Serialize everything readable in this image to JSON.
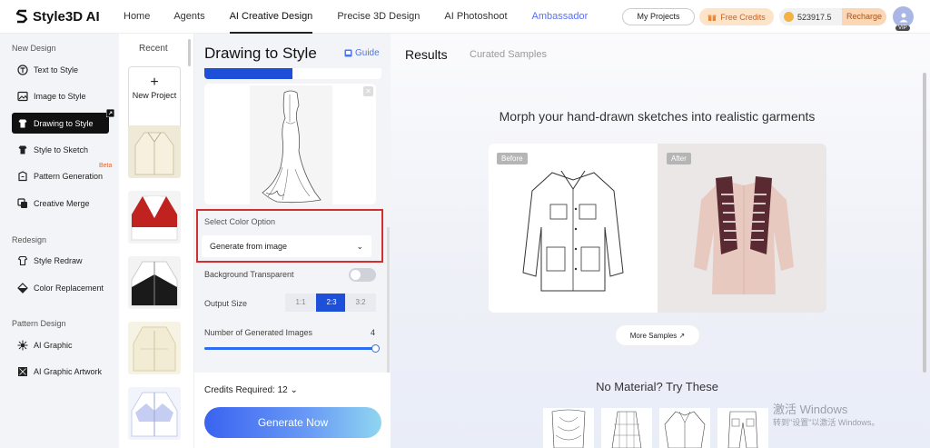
{
  "brand": {
    "name": "Style3D AI"
  },
  "nav": [
    {
      "label": "Home"
    },
    {
      "label": "Agents"
    },
    {
      "label": "AI Creative Design"
    },
    {
      "label": "Precise 3D Design"
    },
    {
      "label": "AI Photoshoot"
    },
    {
      "label": "Ambassador"
    }
  ],
  "top_actions": {
    "my_projects": "My Projects",
    "free_credits": "Free Credits",
    "credit_balance": "523917.5",
    "recharge": "Recharge",
    "vip_badge": "VIP"
  },
  "sidebar": {
    "sections": [
      {
        "title": "New Design"
      },
      {
        "title": "Redesign"
      },
      {
        "title": "Pattern Design"
      }
    ],
    "items": [
      {
        "label": "Text to Style",
        "icon": "text-style-icon"
      },
      {
        "label": "Image to Style",
        "icon": "image-style-icon"
      },
      {
        "label": "Drawing to Style",
        "icon": "drawing-style-icon",
        "active": true
      },
      {
        "label": "Style to Sketch",
        "icon": "sketch-icon"
      },
      {
        "label": "Pattern Generation",
        "icon": "pattern-icon",
        "badge": "Beta"
      },
      {
        "label": "Creative Merge",
        "icon": "merge-icon"
      },
      {
        "label": "Style Redraw",
        "icon": "redraw-icon"
      },
      {
        "label": "Color Replacement",
        "icon": "color-icon"
      },
      {
        "label": "AI Graphic",
        "icon": "graphic-icon"
      },
      {
        "label": "AI Graphic Artwork",
        "icon": "artwork-icon"
      }
    ]
  },
  "recent": {
    "title": "Recent",
    "new_project": "New Project",
    "new_project_icon": "+"
  },
  "panel": {
    "title": "Drawing to Style",
    "guide": "Guide",
    "color_option_label": "Select Color Option",
    "color_option_value": "Generate from image",
    "bg_transparent_label": "Background Transparent",
    "bg_transparent_on": false,
    "output_size_label": "Output Size",
    "output_sizes": [
      "1:1",
      "2:3",
      "3:2"
    ],
    "output_size_selected": "2:3",
    "num_images_label": "Number of Generated Images",
    "num_images_value": "4",
    "num_images_fraction": 1.0,
    "credits_required": "Credits Required: 12",
    "generate_button": "Generate Now"
  },
  "main": {
    "tabs": [
      "Results",
      "Curated Samples"
    ],
    "headline": "Morph your hand-drawn sketches into realistic garments",
    "before_tag": "Before",
    "after_tag": "After",
    "more_samples": "More Samples",
    "no_material": "No Material? Try These"
  },
  "watermark": {
    "line1": "激活 Windows",
    "line2": "转到\"设置\"以激活 Windows。"
  }
}
